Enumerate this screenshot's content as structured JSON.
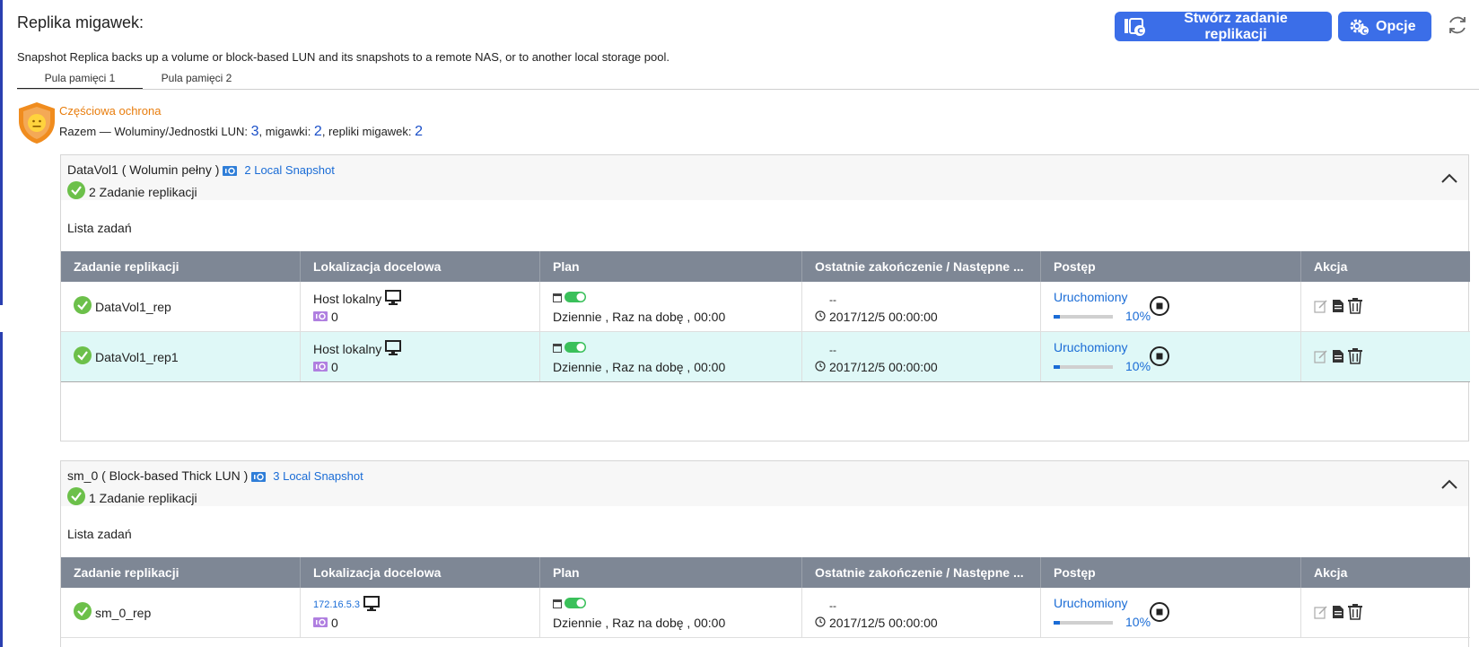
{
  "page": {
    "title": "Replika migawek:",
    "description": "Snapshot Replica backs up a volume or block-based LUN and its snapshots to a remote NAS, or to another local storage pool."
  },
  "toolbar": {
    "create_label": "Stwórz zadanie replikacji",
    "options_label": "Opcje",
    "accent_color": "#3b6ee8"
  },
  "tabs": [
    {
      "label": "Pula pamięci  1",
      "active": true
    },
    {
      "label": "Pula pamięci  2",
      "active": false
    }
  ],
  "protection": {
    "status": "Częściowa ochrona",
    "status_color": "#e87d0d",
    "totals_prefix": "Razem — Woluminy/Jednostki LUN: ",
    "volumes": "3",
    "snapshots_label": ", migawki: ",
    "snapshots": "2",
    "replicas_label": ", repliki migawek: ",
    "replicas": "2"
  },
  "columns": [
    "Zadanie replikacji",
    "Lokalizacja docelowa",
    "Plan",
    "Ostatnie zakończenie / Następne ...",
    "Postęp",
    "Akcja"
  ],
  "cards": [
    {
      "name": "DataVol1 ( Wolumin pełny )",
      "snapshot_link": "2 Local Snapshot",
      "task_count": "2 Zadanie replikacji",
      "list_label": "Lista zadań",
      "rows": [
        {
          "job": "DataVol1_rep",
          "location": "Host lokalny",
          "snap_count": "0",
          "schedule": "Dziennie , Raz na dobę , 00:00",
          "last": "--",
          "next": "2017/12/5 00:00:00",
          "status": "Uruchomiony",
          "progress": "10%",
          "selected": false
        },
        {
          "job": "DataVol1_rep1",
          "location": "Host lokalny",
          "snap_count": "0",
          "schedule": "Dziennie , Raz na dobę , 00:00",
          "last": "--",
          "next": "2017/12/5 00:00:00",
          "status": "Uruchomiony",
          "progress": "10%",
          "selected": true
        }
      ]
    },
    {
      "name": "sm_0 ( Block-based Thick LUN )",
      "snapshot_link": "3 Local Snapshot",
      "task_count": "1 Zadanie replikacji",
      "list_label": "Lista zadań",
      "rows": [
        {
          "job": "sm_0_rep",
          "location": "172.16.5.3",
          "snap_count": "0",
          "schedule": "Dziennie , Raz na dobę , 00:00",
          "last": "--",
          "next": "2017/12/5 00:00:00",
          "status": "Uruchomiony",
          "progress": "10%",
          "selected": false
        }
      ]
    }
  ]
}
